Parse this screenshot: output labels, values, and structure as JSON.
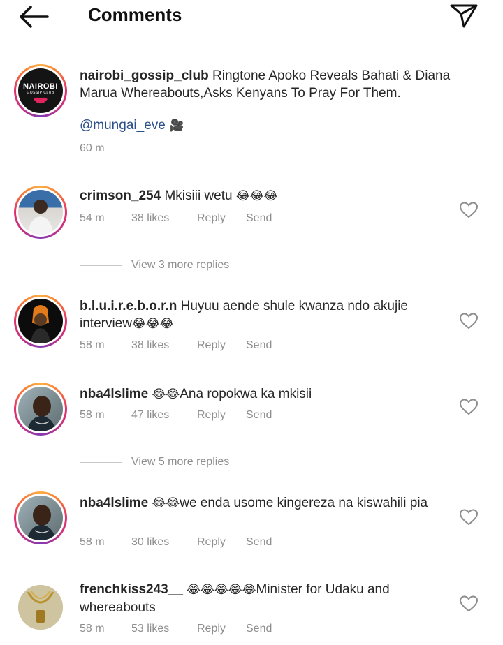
{
  "header": {
    "title": "Comments"
  },
  "caption": {
    "username": "nairobi_gossip_club",
    "text": "Ringtone Apoko Reveals Bahati & Diana Marua Whereabouts,Asks Kenyans To Pray For Them.",
    "mention": "@mungai_eve",
    "mention_icon": "🎥",
    "time": "60 m",
    "logo_line1": "NAIROBI",
    "logo_line2": "GOSSIP CLUB"
  },
  "comments": [
    {
      "username": "crimson_254",
      "text": "Mkisiii wetu",
      "emoji": "😂😂😂",
      "time": "54 m",
      "likes": "38 likes",
      "reply": "Reply",
      "send": "Send"
    },
    {
      "username": "b.l.u.i.r.e.b.o.r.n",
      "text": "Huyuu aende shule kwanza ndo akujie interview",
      "emoji": "😂😂😂",
      "time": "58 m",
      "likes": "38 likes",
      "reply": "Reply",
      "send": "Send"
    },
    {
      "username": "nba4lslime",
      "emoji": "😂😂",
      "text": "Ana ropokwa ka mkisii",
      "time": "58 m",
      "likes": "47 likes",
      "reply": "Reply",
      "send": "Send"
    },
    {
      "username": "nba4lslime",
      "emoji": "😂😂",
      "text": "we enda usome kingereza na kiswahili pia",
      "time": "58 m",
      "likes": "30 likes",
      "reply": "Reply",
      "send": "Send"
    },
    {
      "username": "frenchkiss243__",
      "emoji": "😂😂😂😂😂",
      "text": "Minister for Udaku and whereabouts",
      "time": "58 m",
      "likes": "53 likes",
      "reply": "Reply",
      "send": "Send"
    }
  ],
  "view_replies": [
    {
      "label": "View 3 more replies"
    },
    {
      "label": "View 5 more replies"
    }
  ],
  "icons": {
    "back": "arrow-left-icon",
    "send": "paper-plane-icon",
    "like": "heart-icon"
  },
  "colors": {
    "mention": "#2c4e8a",
    "secondary_text": "#8e8e8e",
    "story_ring": "#e1306c"
  }
}
